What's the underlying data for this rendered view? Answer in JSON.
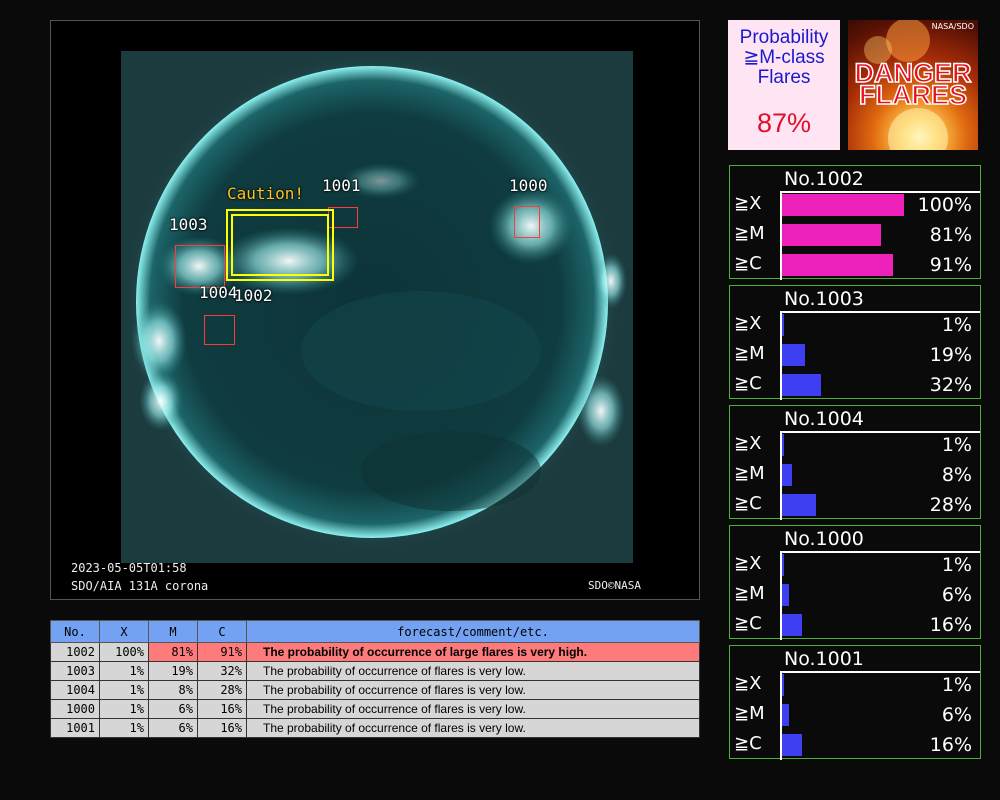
{
  "image": {
    "timestamp": "2023-05-05T01:58",
    "instrument": "SDO/AIA 131A corona",
    "credit": "SDO©NASA",
    "caution_label": "Caution!",
    "regions": [
      {
        "id": "1000",
        "label": "1000"
      },
      {
        "id": "1001",
        "label": "1001"
      },
      {
        "id": "1002",
        "label": "1002"
      },
      {
        "id": "1003",
        "label": "1003"
      },
      {
        "id": "1004",
        "label": "1004"
      }
    ]
  },
  "probability_card": {
    "title": "Probability ≧M-class Flares",
    "value": "87%"
  },
  "danger_banner": {
    "credit": "NASA/SDO",
    "line1": "DANGER",
    "line2": "FLARES"
  },
  "region_cards": [
    {
      "title": "No.1002",
      "severity": "high",
      "bar_color": "#ee22bb",
      "rows": [
        {
          "label": "≧X",
          "value": 100,
          "pct": "100%"
        },
        {
          "label": "≧M",
          "value": 81,
          "pct": "81%"
        },
        {
          "label": "≧C",
          "value": 91,
          "pct": "91%"
        }
      ]
    },
    {
      "title": "No.1003",
      "severity": "low",
      "bar_color": "#3e3ef2",
      "rows": [
        {
          "label": "≧X",
          "value": 1,
          "pct": "1%"
        },
        {
          "label": "≧M",
          "value": 19,
          "pct": "19%"
        },
        {
          "label": "≧C",
          "value": 32,
          "pct": "32%"
        }
      ]
    },
    {
      "title": "No.1004",
      "severity": "low",
      "bar_color": "#3e3ef2",
      "rows": [
        {
          "label": "≧X",
          "value": 1,
          "pct": "1%"
        },
        {
          "label": "≧M",
          "value": 8,
          "pct": "8%"
        },
        {
          "label": "≧C",
          "value": 28,
          "pct": "28%"
        }
      ]
    },
    {
      "title": "No.1000",
      "severity": "low",
      "bar_color": "#3e3ef2",
      "rows": [
        {
          "label": "≧X",
          "value": 1,
          "pct": "1%"
        },
        {
          "label": "≧M",
          "value": 6,
          "pct": "6%"
        },
        {
          "label": "≧C",
          "value": 16,
          "pct": "16%"
        }
      ]
    },
    {
      "title": "No.1001",
      "severity": "low",
      "bar_color": "#3e3ef2",
      "rows": [
        {
          "label": "≧X",
          "value": 1,
          "pct": "1%"
        },
        {
          "label": "≧M",
          "value": 6,
          "pct": "6%"
        },
        {
          "label": "≧C",
          "value": 16,
          "pct": "16%"
        }
      ]
    }
  ],
  "table": {
    "headers": [
      "No.",
      "X",
      "M",
      "C",
      "forecast/comment/etc."
    ],
    "rows": [
      {
        "no": "1002",
        "x": "100%",
        "m": "81%",
        "c": "91%",
        "comment": "The probability of occurrence of large flares is very high.",
        "danger": true
      },
      {
        "no": "1003",
        "x": "1%",
        "m": "19%",
        "c": "32%",
        "comment": "The probability of occurrence of flares is very low.",
        "danger": false
      },
      {
        "no": "1004",
        "x": "1%",
        "m": "8%",
        "c": "28%",
        "comment": "The probability of occurrence of flares is very low.",
        "danger": false
      },
      {
        "no": "1000",
        "x": "1%",
        "m": "6%",
        "c": "16%",
        "comment": "The probability of occurrence of flares is very low.",
        "danger": false
      },
      {
        "no": "1001",
        "x": "1%",
        "m": "6%",
        "c": "16%",
        "comment": "The probability of occurrence of flares is very low.",
        "danger": false
      }
    ]
  },
  "colors": {
    "high_bar": "#ee22bb",
    "low_bar": "#3e3ef2",
    "card_border": "#4caf3a",
    "table_header": "#74a2f2",
    "danger_row": "#ff7b7b",
    "region_box": "#ff3a3a",
    "caution_box": "#ffff00"
  }
}
